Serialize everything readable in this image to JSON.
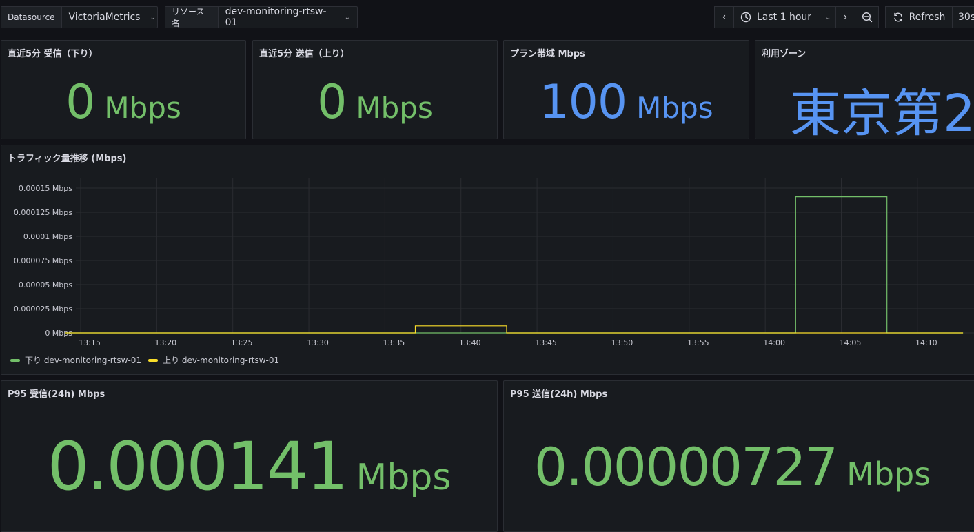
{
  "toolbar": {
    "datasource_label": "Datasource",
    "datasource_value": "VictoriaMetrics",
    "resource_label": "リソース名",
    "resource_value": "dev-monitoring-rtsw-01",
    "time_range": "Last 1 hour",
    "refresh_label": "Refresh",
    "refresh_interval": "30s"
  },
  "panels": {
    "rx5m": {
      "title": "直近5分 受信（下り）",
      "value": "0",
      "unit": "Mbps",
      "color": "#73bf69"
    },
    "tx5m": {
      "title": "直近5分 送信（上り）",
      "value": "0",
      "unit": "Mbps",
      "color": "#73bf69"
    },
    "plan": {
      "title": "プラン帯域 Mbps",
      "value": "100",
      "unit": "Mbps",
      "color": "#5794f2"
    },
    "zone": {
      "title": "利用ゾーン",
      "value": "東京第2",
      "color": "#5794f2"
    },
    "p95rx": {
      "title": "P95 受信(24h) Mbps",
      "value": "0.000141",
      "unit": "Mbps",
      "color": "#73bf69"
    },
    "p95tx": {
      "title": "P95 送信(24h) Mbps",
      "value": "0.00000727",
      "unit": "Mbps",
      "color": "#73bf69"
    }
  },
  "chart_data": {
    "type": "line",
    "title": "トラフィック量推移 (Mbps)",
    "y_ticks": [
      "0 Mbps",
      "0.000025 Mbps",
      "0.00005 Mbps",
      "0.000075 Mbps",
      "0.0001 Mbps",
      "0.000125 Mbps",
      "0.00015 Mbps"
    ],
    "ylim": [
      0,
      0.00015
    ],
    "x_ticks": [
      "13:15",
      "13:20",
      "13:25",
      "13:30",
      "13:35",
      "13:40",
      "13:45",
      "13:50",
      "13:55",
      "14:00",
      "14:05",
      "14:10"
    ],
    "xlim": [
      "13:14",
      "14:13"
    ],
    "grid": true,
    "legend_position": "bottom-left",
    "series": [
      {
        "name": "下り dev-monitoring-rtsw-01",
        "color": "#73bf69",
        "points": [
          [
            "13:14",
            0
          ],
          [
            "14:02",
            0
          ],
          [
            "14:02",
            0.000141
          ],
          [
            "14:08",
            0.000141
          ],
          [
            "14:08",
            0
          ],
          [
            "14:13",
            0
          ]
        ]
      },
      {
        "name": "上り dev-monitoring-rtsw-01",
        "color": "#fade2a",
        "points": [
          [
            "13:14",
            0
          ],
          [
            "13:37",
            0
          ],
          [
            "13:37",
            7.27e-06
          ],
          [
            "13:43",
            7.27e-06
          ],
          [
            "13:43",
            0
          ],
          [
            "14:13",
            0
          ]
        ]
      }
    ]
  }
}
